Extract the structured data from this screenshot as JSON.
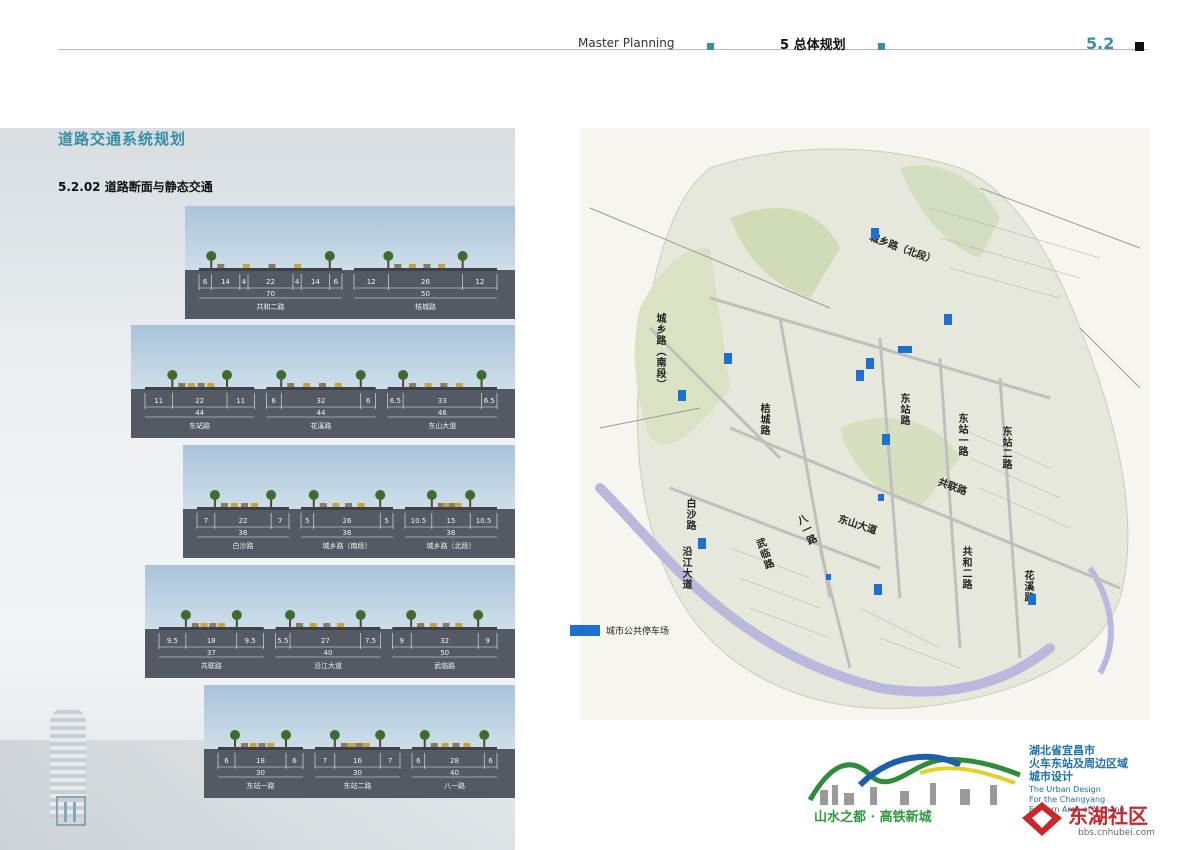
{
  "header": {
    "english": "Master Planning",
    "section": "5 总体规划",
    "number": "5.2"
  },
  "title": "道路交通系统规划",
  "subtitle": "5.2.02 道路断面与静态交通",
  "sections": [
    {
      "roads": [
        {
          "name": "共和二路",
          "total": "70",
          "parts": [
            "6",
            "14",
            "4",
            "22",
            "4",
            "14",
            "6"
          ]
        },
        {
          "name": "桔城路",
          "total": "50",
          "parts": [
            "12",
            "26",
            "12"
          ]
        }
      ]
    },
    {
      "roads": [
        {
          "name": "东站路",
          "total": "44",
          "parts": [
            "11",
            "22",
            "11"
          ]
        },
        {
          "name": "花溪路",
          "total": "44",
          "parts": [
            "6",
            "32",
            "6"
          ]
        },
        {
          "name": "东山大道",
          "total": "46",
          "parts": [
            "6.5",
            "33",
            "6.5"
          ]
        }
      ]
    },
    {
      "roads": [
        {
          "name": "白沙路",
          "total": "36",
          "parts": [
            "7",
            "22",
            "7"
          ]
        },
        {
          "name": "城乡路（南段）",
          "total": "36",
          "parts": [
            "5",
            "26",
            "5"
          ]
        },
        {
          "name": "城乡路（北段）",
          "total": "36",
          "parts": [
            "10.5",
            "15",
            "10.5"
          ]
        }
      ]
    },
    {
      "roads": [
        {
          "name": "共联路",
          "total": "37",
          "parts": [
            "9.5",
            "18",
            "9.5"
          ]
        },
        {
          "name": "沿江大道",
          "total": "40",
          "parts": [
            "5.5",
            "27",
            "7.5"
          ]
        },
        {
          "name": "武临路",
          "total": "50",
          "parts": [
            "9",
            "32",
            "9"
          ]
        }
      ]
    },
    {
      "roads": [
        {
          "name": "东站一路",
          "total": "30",
          "parts": [
            "6",
            "18",
            "6"
          ]
        },
        {
          "name": "东站二路",
          "total": "30",
          "parts": [
            "7",
            "16",
            "7"
          ]
        },
        {
          "name": "八一路",
          "total": "40",
          "parts": [
            "6",
            "28",
            "6"
          ]
        }
      ]
    }
  ],
  "map_labels": {
    "chengxiang_north": "城乡路（北段）",
    "chengxiang_south": "城乡路（南段）",
    "jucheng": "桔城路",
    "dongzhan": "东站路",
    "dongzhan1": "东站一路",
    "dongzhan2": "东站二路",
    "gonglian": "共联路",
    "dongshan": "东山大道",
    "bayi": "八一路",
    "baisha": "白沙路",
    "wulin": "武临路",
    "yanjiang": "沿江大道",
    "gonghe2": "共和二路",
    "huaxi": "花溪路"
  },
  "legend": {
    "parking": "城市公共停车场",
    "color": "#1f6fd1"
  },
  "brand": {
    "title": "湖北省宜昌市\n火车东站及周边区域\n城市设计",
    "english": "The Urban Design\nFor the Changyang\nEastern Area of Yichang",
    "slogan": "山水之都 · 高铁新城"
  },
  "watermark": {
    "cn": "东湖社区",
    "url": "bbs.cnhubei.com"
  },
  "colors": {
    "accent": "#3a8fa5",
    "ground": "#545a64",
    "parking": "#1f6fd1"
  }
}
